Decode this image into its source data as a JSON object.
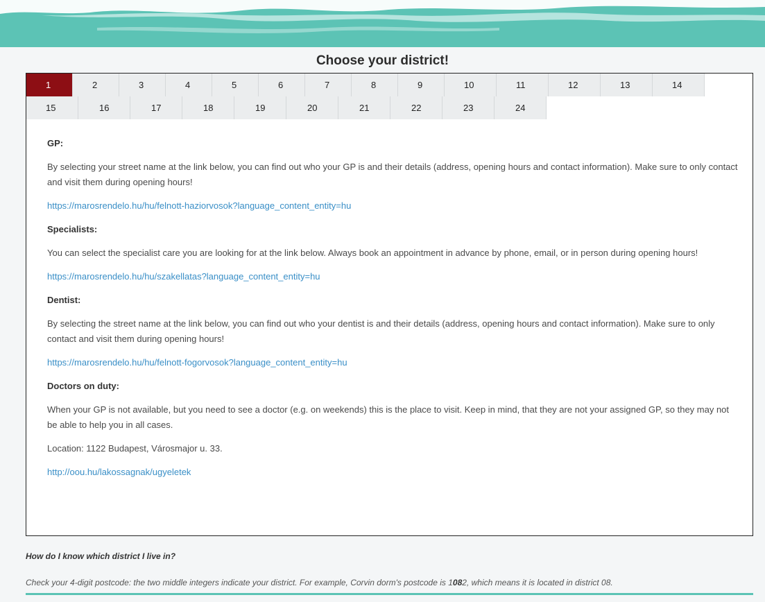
{
  "colors": {
    "banner": "#5cc3b5",
    "active_tab": "#8d0e14",
    "link": "#3a8fc7"
  },
  "page": {
    "title": "Choose your district!"
  },
  "tabs": {
    "row1": [
      "1",
      "2",
      "3",
      "4",
      "5",
      "6",
      "7",
      "8",
      "9",
      "10",
      "11",
      "12",
      "13",
      "14"
    ],
    "row2": [
      "15",
      "16",
      "17",
      "18",
      "19",
      "20",
      "21",
      "22",
      "23",
      "24"
    ],
    "active": "1"
  },
  "content": {
    "gp": {
      "heading": "GP:",
      "text": "By selecting your street name at the link below, you can find out who your GP is and their details (address, opening hours and contact information). Make sure to only contact and visit them during opening hours!",
      "link": "https://marosrendelo.hu/hu/felnott-haziorvosok?language_content_entity=hu"
    },
    "specialists": {
      "heading": "Specialists:",
      "text": "You can select the specialist care you are looking for at the link below. Always book an appointment in advance by phone, email, or in person during opening hours!",
      "link": "https://marosrendelo.hu/hu/szakellatas?language_content_entity=hu"
    },
    "dentist": {
      "heading": "Dentist:",
      "text": "By selecting the street name at the link below, you can find out who your dentist is and their details (address, opening hours and contact information). Make sure to only contact and visit them during opening hours!",
      "link": "https://marosrendelo.hu/hu/felnott-fogorvosok?language_content_entity=hu"
    },
    "on_duty": {
      "heading": "Doctors on duty:",
      "text": "When your GP is not available, but you need to see a doctor (e.g. on weekends) this is the place to visit. Keep in mind, that they are not your assigned GP, so they may not be able to help you in all cases.",
      "location": "Location: 1122 Budapest, Városmajor u. 33.",
      "link": "http://oou.hu/lakossagnak/ugyeletek"
    }
  },
  "faq": {
    "question": "How do I know which district I live in?",
    "answer_prefix": "Check your 4-digit postcode: the two middle integers indicate your district. For example, Corvin dorm's postcode is ",
    "answer_code_first": "1",
    "answer_code_bold": "08",
    "answer_code_last": "2",
    "answer_suffix": ", which means it is located in district 08."
  }
}
